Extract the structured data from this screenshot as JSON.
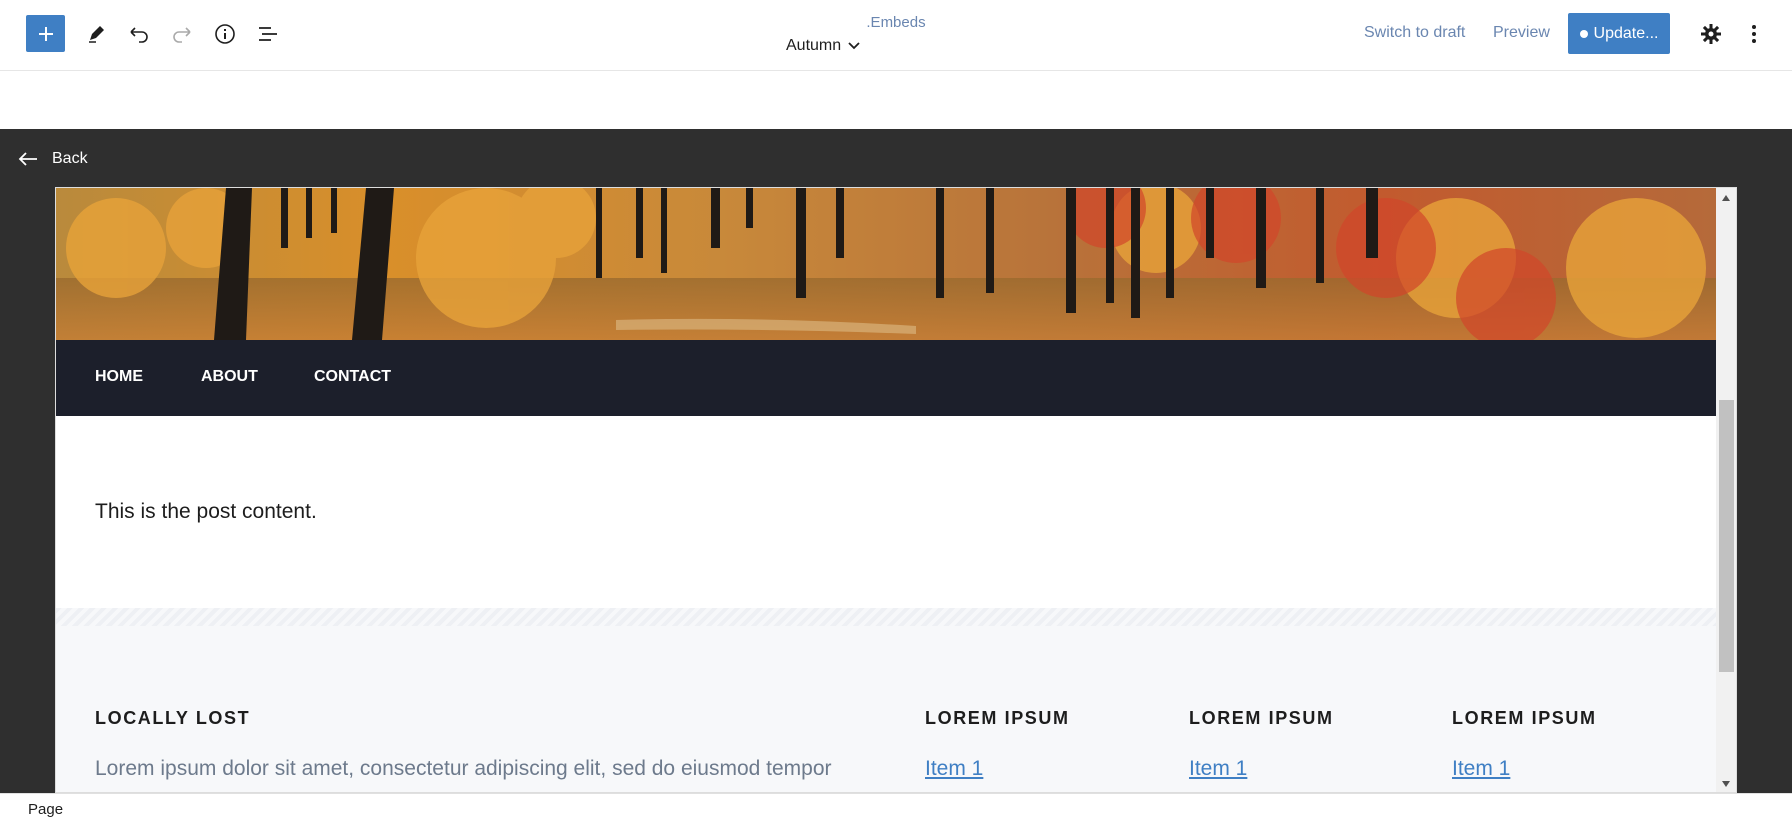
{
  "header": {
    "title": ".Embeds",
    "template": "Autumn",
    "switch_draft": "Switch to draft",
    "preview": "Preview",
    "update": "Update..."
  },
  "back": "Back",
  "nav": [
    "HOME",
    "ABOUT",
    "CONTACT"
  ],
  "content": "This is the post content.",
  "footer": {
    "col1_title": "LOCALLY LOST",
    "col1_text": "Lorem ipsum dolor sit amet, consectetur adipiscing elit, sed do eiusmod tempor",
    "cols": [
      {
        "title": "LOREM IPSUM",
        "item": "Item 1"
      },
      {
        "title": "LOREM IPSUM",
        "item": "Item 1"
      },
      {
        "title": "LOREM IPSUM",
        "item": "Item 1"
      }
    ]
  },
  "status": "Page",
  "colors": {
    "accent": "#3f7fc4",
    "nav_bg": "#1c1f2b",
    "canvas_bg": "#2f2f2f"
  }
}
